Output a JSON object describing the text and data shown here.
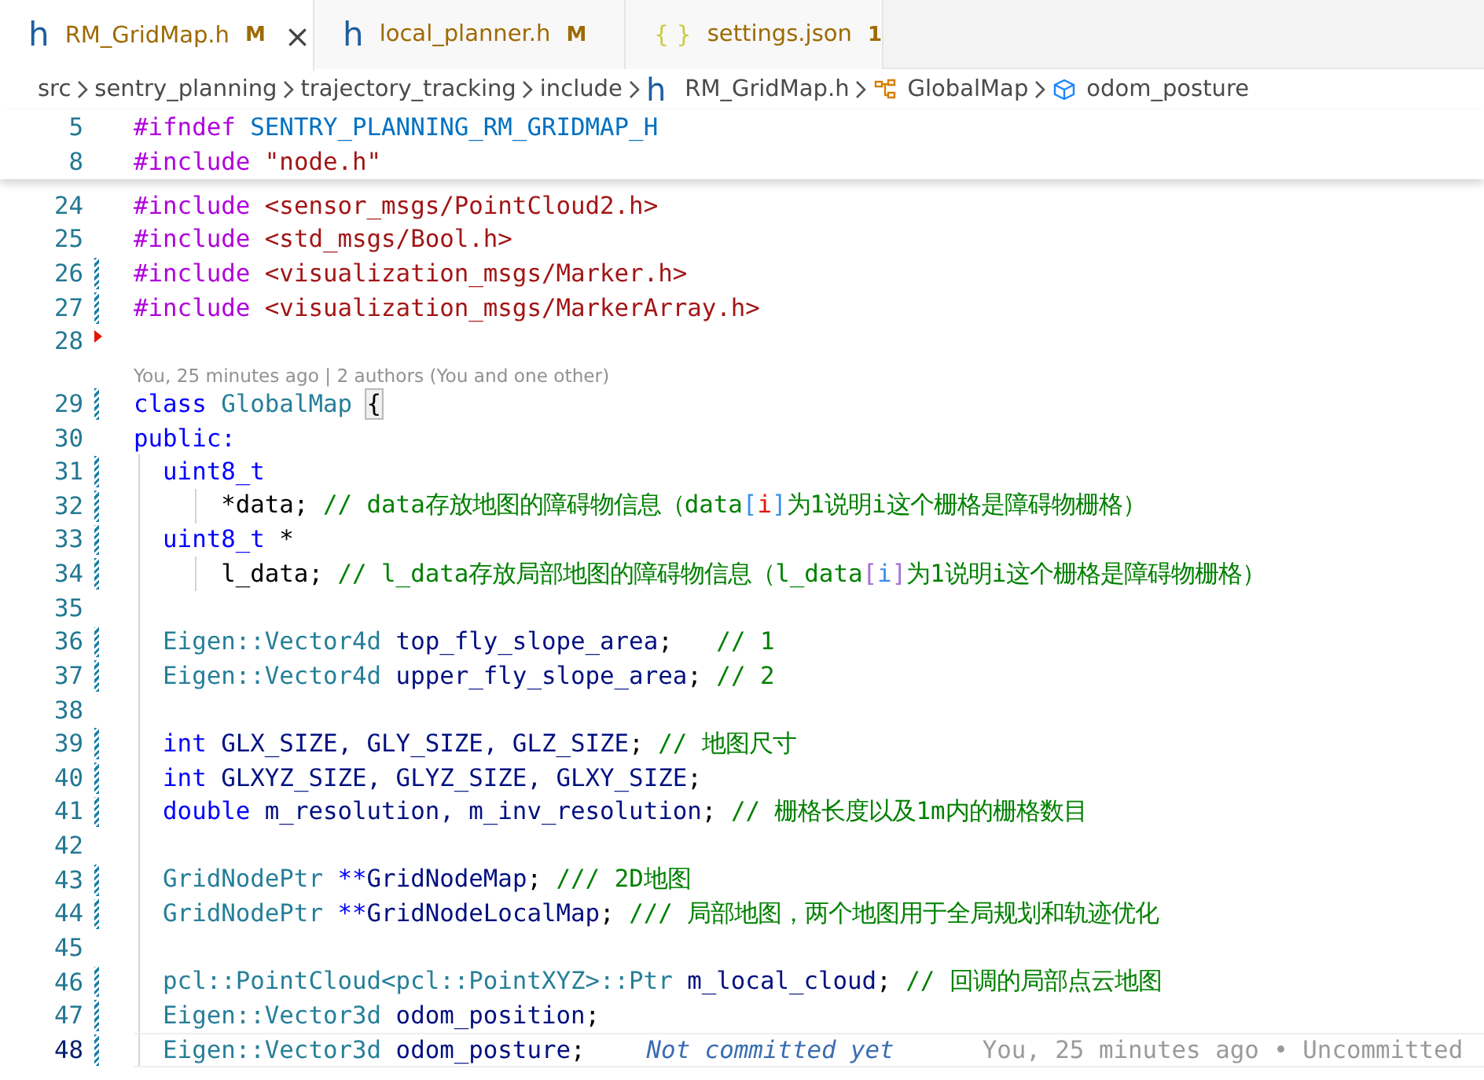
{
  "tabs": [
    {
      "kind": "c-header",
      "icon": "h",
      "label": "RM_GridMap.h",
      "badge": "M",
      "close": "×",
      "selected": true
    },
    {
      "kind": "c-header",
      "icon": "h",
      "label": "local_planner.h",
      "badge": "M",
      "selected": false
    },
    {
      "kind": "json",
      "icon": "{ }",
      "label": "settings.json",
      "badge": "1",
      "selected": false
    }
  ],
  "breadcrumbs": [
    {
      "kind": "folder",
      "label": "src"
    },
    {
      "kind": "folder",
      "label": "sentry_planning"
    },
    {
      "kind": "folder",
      "label": "trajectory_tracking"
    },
    {
      "kind": "folder",
      "label": "include"
    },
    {
      "kind": "file",
      "icon": "h",
      "label": "RM_GridMap.h"
    },
    {
      "kind": "class",
      "label": "GlobalMap"
    },
    {
      "kind": "field",
      "label": "odom_posture"
    }
  ],
  "sticky_lines": [
    {
      "number": "5",
      "tokens": [
        {
          "kind": "directive",
          "text": "#ifndef"
        },
        {
          "kind": "macro",
          "text": " SENTRY_PLANNING_RM_GRIDMAP_H"
        }
      ]
    },
    {
      "number": "8",
      "tokens": [
        {
          "kind": "directive",
          "text": "#include"
        },
        {
          "kind": "string",
          "text": " \"node.h\""
        }
      ]
    }
  ],
  "lines": [
    {
      "kind": "code",
      "number": "24",
      "modified": false,
      "deleted": false,
      "current": false,
      "tokens": [
        {
          "kind": "directive",
          "text": "#include"
        },
        {
          "kind": "string",
          "text": " <sensor_msgs/PointCloud2.h>"
        }
      ]
    },
    {
      "kind": "code",
      "number": "25",
      "modified": false,
      "deleted": false,
      "current": false,
      "tokens": [
        {
          "kind": "directive",
          "text": "#include"
        },
        {
          "kind": "string",
          "text": " <std_msgs/Bool.h>"
        }
      ]
    },
    {
      "kind": "code",
      "number": "26",
      "modified": true,
      "deleted": false,
      "current": false,
      "tokens": [
        {
          "kind": "directive",
          "text": "#include"
        },
        {
          "kind": "string",
          "text": " <visualization_msgs/Marker.h>"
        }
      ]
    },
    {
      "kind": "code",
      "number": "27",
      "modified": true,
      "deleted": false,
      "current": false,
      "tokens": [
        {
          "kind": "directive",
          "text": "#include"
        },
        {
          "kind": "string",
          "text": " <visualization_msgs/MarkerArray.h>"
        }
      ]
    },
    {
      "kind": "code",
      "number": "28",
      "modified": false,
      "deleted": true,
      "current": false
    },
    {
      "kind": "codelens",
      "text": "You, 25 minutes ago | 2 authors (You and one other)"
    },
    {
      "kind": "code",
      "number": "29",
      "modified": true,
      "deleted": false,
      "current": false,
      "tokens": [
        {
          "kind": "keyword",
          "text": "class"
        },
        {
          "kind": "type",
          "text": " GlobalMap "
        },
        {
          "kind": "bracket-match",
          "text": "{"
        }
      ]
    },
    {
      "kind": "code",
      "number": "30",
      "modified": false,
      "deleted": false,
      "current": false,
      "tokens": [
        {
          "kind": "keyword",
          "text": "public:"
        }
      ]
    },
    {
      "kind": "code",
      "number": "31",
      "modified": true,
      "deleted": false,
      "current": false,
      "tokens": [
        {
          "kind": "keyword",
          "text": "  uint8_t"
        }
      ]
    },
    {
      "kind": "code",
      "number": "32",
      "modified": true,
      "deleted": false,
      "current": false,
      "tokens": [
        {
          "kind": "plain",
          "text": "      *data;"
        },
        {
          "kind": "comment",
          "text": " // data存放地图的障碍物信息（data"
        },
        {
          "kind": "bracket-blue",
          "text": "["
        },
        {
          "kind": "bracket-red",
          "text": "i"
        },
        {
          "kind": "bracket-blue",
          "text": "]"
        },
        {
          "kind": "comment",
          "text": "为1说明i这个栅格是障碍物栅格）"
        }
      ]
    },
    {
      "kind": "code",
      "number": "33",
      "modified": true,
      "deleted": false,
      "current": false,
      "tokens": [
        {
          "kind": "keyword",
          "text": "  uint8_t"
        },
        {
          "kind": "plain",
          "text": " *"
        }
      ]
    },
    {
      "kind": "code",
      "number": "34",
      "modified": true,
      "deleted": false,
      "current": false,
      "tokens": [
        {
          "kind": "plain",
          "text": "      l_data;"
        },
        {
          "kind": "comment",
          "text": " // l_data存放局部地图的障碍物信息（l_data"
        },
        {
          "kind": "bracket-purple",
          "text": "["
        },
        {
          "kind": "bracket-blue",
          "text": "i"
        },
        {
          "kind": "bracket-purple",
          "text": "]"
        },
        {
          "kind": "comment",
          "text": "为1说明i这个栅格是障碍物栅格）"
        }
      ]
    },
    {
      "kind": "code",
      "number": "35",
      "modified": false,
      "deleted": false,
      "current": false
    },
    {
      "kind": "code",
      "number": "36",
      "modified": true,
      "deleted": false,
      "current": false,
      "tokens": [
        {
          "kind": "type",
          "text": "  Eigen::Vector4d"
        },
        {
          "kind": "variable",
          "text": " top_fly_slope_area"
        },
        {
          "kind": "plain",
          "text": ";"
        },
        {
          "kind": "comment",
          "text": "   // 1"
        }
      ]
    },
    {
      "kind": "code",
      "number": "37",
      "modified": true,
      "deleted": false,
      "current": false,
      "tokens": [
        {
          "kind": "type",
          "text": "  Eigen::Vector4d"
        },
        {
          "kind": "variable",
          "text": " upper_fly_slope_area"
        },
        {
          "kind": "plain",
          "text": ";"
        },
        {
          "kind": "comment",
          "text": " // 2"
        }
      ]
    },
    {
      "kind": "code",
      "number": "38",
      "modified": false,
      "deleted": false,
      "current": false
    },
    {
      "kind": "code",
      "number": "39",
      "modified": true,
      "deleted": false,
      "current": false,
      "tokens": [
        {
          "kind": "keyword",
          "text": "  int"
        },
        {
          "kind": "variable",
          "text": " GLX_SIZE, GLY_SIZE, GLZ_SIZE"
        },
        {
          "kind": "plain",
          "text": ";"
        },
        {
          "kind": "comment",
          "text": " // 地图尺寸"
        }
      ]
    },
    {
      "kind": "code",
      "number": "40",
      "modified": true,
      "deleted": false,
      "current": false,
      "tokens": [
        {
          "kind": "keyword",
          "text": "  int"
        },
        {
          "kind": "variable",
          "text": " GLXYZ_SIZE, GLYZ_SIZE, GLXY_SIZE"
        },
        {
          "kind": "plain",
          "text": ";"
        }
      ]
    },
    {
      "kind": "code",
      "number": "41",
      "modified": true,
      "deleted": false,
      "current": false,
      "tokens": [
        {
          "kind": "keyword",
          "text": "  double"
        },
        {
          "kind": "variable",
          "text": " m_resolution, m_inv_resolution"
        },
        {
          "kind": "plain",
          "text": ";"
        },
        {
          "kind": "comment",
          "text": " // 栅格长度以及1m内的栅格数目"
        }
      ]
    },
    {
      "kind": "code",
      "number": "42",
      "modified": false,
      "deleted": false,
      "current": false
    },
    {
      "kind": "code",
      "number": "43",
      "modified": true,
      "deleted": false,
      "current": false,
      "tokens": [
        {
          "kind": "type",
          "text": "  GridNodePtr"
        },
        {
          "kind": "keyword",
          "text": " **"
        },
        {
          "kind": "variable",
          "text": "GridNodeMap"
        },
        {
          "kind": "plain",
          "text": ";"
        },
        {
          "kind": "comment",
          "text": " /// 2D地图"
        }
      ]
    },
    {
      "kind": "code",
      "number": "44",
      "modified": true,
      "deleted": false,
      "current": false,
      "tokens": [
        {
          "kind": "type",
          "text": "  GridNodePtr"
        },
        {
          "kind": "keyword",
          "text": " **"
        },
        {
          "kind": "variable",
          "text": "GridNodeLocalMap"
        },
        {
          "kind": "plain",
          "text": ";"
        },
        {
          "kind": "comment",
          "text": " /// 局部地图，两个地图用于全局规划和轨迹优化"
        }
      ]
    },
    {
      "kind": "code",
      "number": "45",
      "modified": false,
      "deleted": false,
      "current": false
    },
    {
      "kind": "code",
      "number": "46",
      "modified": true,
      "deleted": false,
      "current": false,
      "tokens": [
        {
          "kind": "type",
          "text": "  pcl::PointCloud<pcl::PointXYZ>::Ptr"
        },
        {
          "kind": "variable",
          "text": " m_local_cloud"
        },
        {
          "kind": "plain",
          "text": ";"
        },
        {
          "kind": "comment",
          "text": " // 回调的局部点云地图"
        }
      ]
    },
    {
      "kind": "code",
      "number": "47",
      "modified": true,
      "deleted": false,
      "current": false,
      "tokens": [
        {
          "kind": "type",
          "text": "  Eigen::Vector3d"
        },
        {
          "kind": "variable",
          "text": " odom_position"
        },
        {
          "kind": "plain",
          "text": ";"
        }
      ]
    },
    {
      "kind": "code",
      "number": "48",
      "modified": true,
      "deleted": false,
      "current": true,
      "tokens": [
        {
          "kind": "type",
          "text": "  Eigen::Vector3d"
        },
        {
          "kind": "variable",
          "text": " odom_posture"
        },
        {
          "kind": "plain",
          "text": ";"
        }
      ],
      "hint": "Not committed yet",
      "blame": "You, 25 minutes ago • Uncommitted"
    }
  ]
}
